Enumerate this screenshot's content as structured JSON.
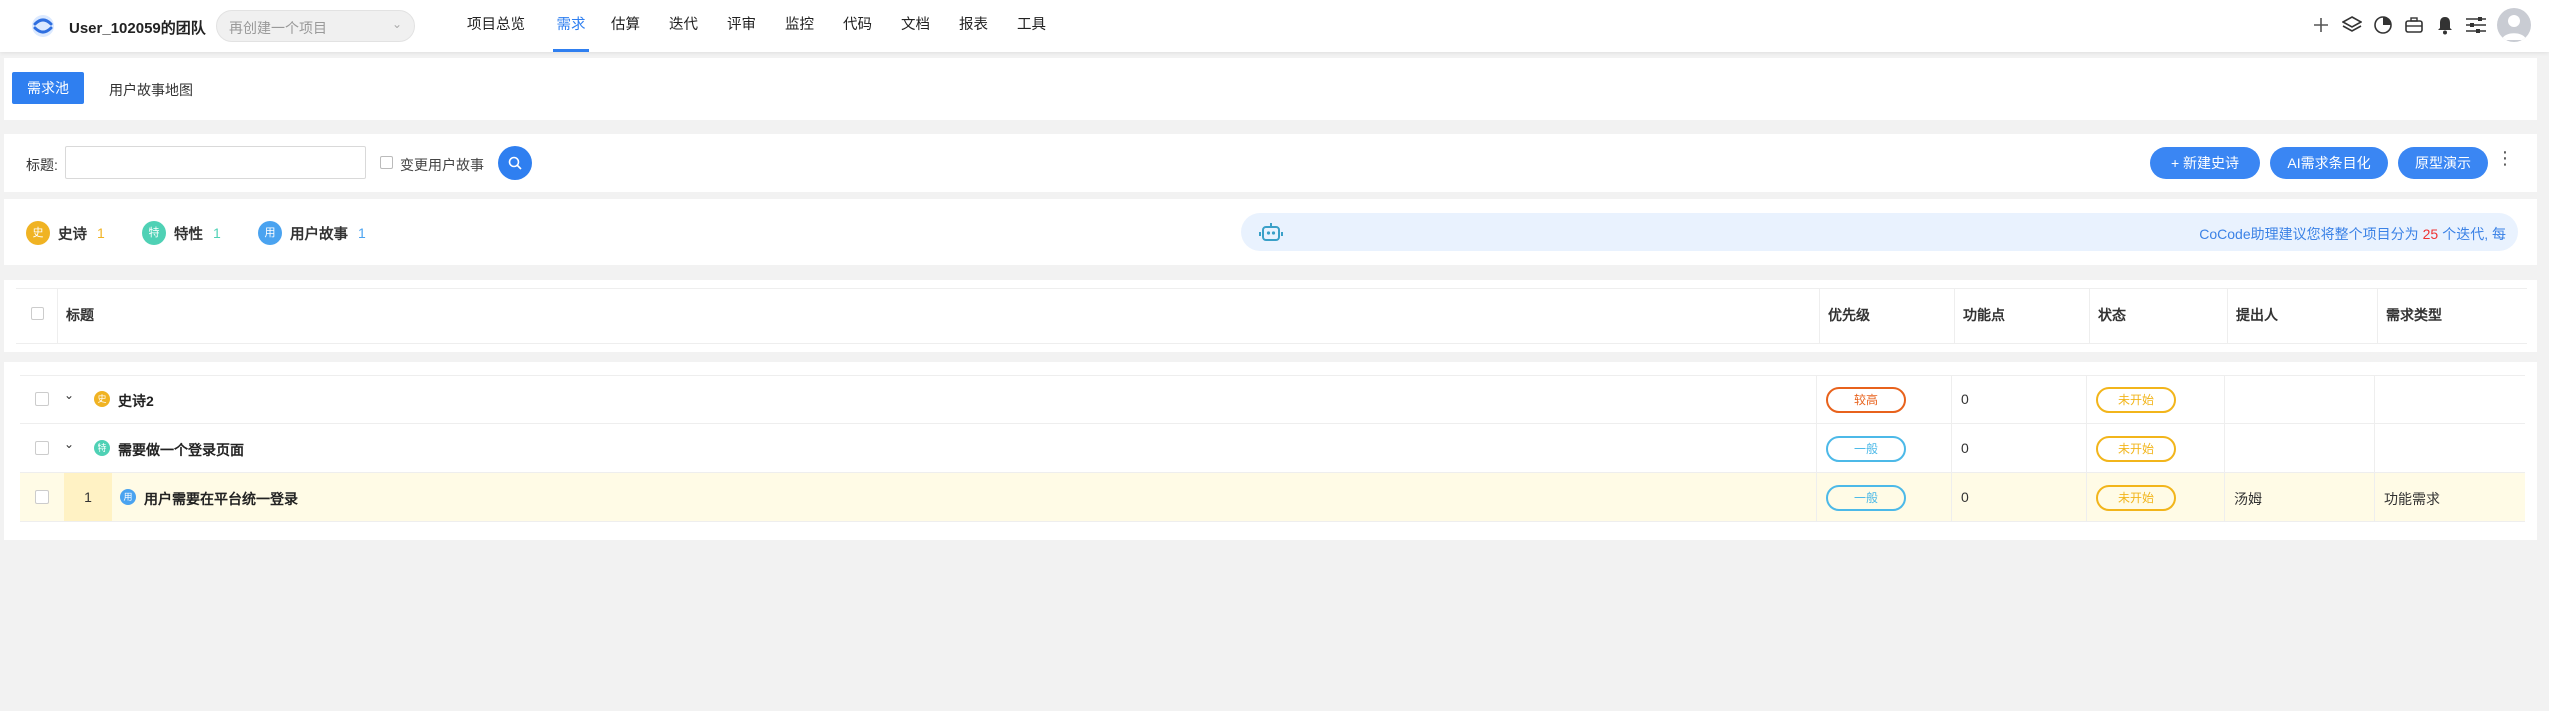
{
  "topbar": {
    "team_name": "User_102059的团队",
    "project_select_placeholder": "再创建一个项目",
    "nav": [
      "项目总览",
      "需求",
      "估算",
      "迭代",
      "评审",
      "监控",
      "代码",
      "文档",
      "报表",
      "工具"
    ],
    "active_nav": "需求",
    "icons": [
      "plus-icon",
      "layers-icon",
      "pie-chart-icon",
      "briefcase-icon",
      "bell-icon",
      "sliders-icon",
      "user-avatar-icon"
    ]
  },
  "tabs": {
    "active": "需求池",
    "other": "用户故事地图"
  },
  "filter": {
    "title_label": "标题:",
    "title_value": "",
    "checkbox_label": "变更用户故事",
    "buttons": {
      "new_epic": "+ 新建史诗",
      "ai_catalog": "AI需求条目化",
      "prototype": "原型演示"
    }
  },
  "stats": {
    "items": [
      {
        "badge": "史",
        "name": "史诗",
        "count": "1",
        "color": "#f0b323"
      },
      {
        "badge": "特",
        "name": "特性",
        "count": "1",
        "color": "#4fd1b5"
      },
      {
        "badge": "用",
        "name": "用户故事",
        "count": "1",
        "color": "#4aa3f0"
      }
    ],
    "assistant_text_before": "CoCode助理建议您将整个项目分为",
    "assistant_number": "25",
    "assistant_text_after": "个迭代, 每"
  },
  "table": {
    "headers": {
      "title": "标题",
      "priority": "优先级",
      "function_points": "功能点",
      "status": "状态",
      "proposer": "提出人",
      "type": "需求类型"
    },
    "rows": [
      {
        "kind_badge": "史",
        "title": "史诗2",
        "priority": "较高",
        "function_points": "0",
        "status": "未开始",
        "proposer": "",
        "type": ""
      },
      {
        "kind_badge": "特",
        "title": "需要做一个登录页面",
        "priority": "一般",
        "function_points": "0",
        "status": "未开始",
        "proposer": "",
        "type": ""
      },
      {
        "number": "1",
        "kind_badge": "用",
        "title": "用户需要在平台统一登录",
        "priority": "一般",
        "function_points": "0",
        "status": "未开始",
        "proposer": "汤姆",
        "type": "功能需求"
      }
    ]
  },
  "colors": {
    "accent": "#2f7ff0",
    "priority_high": "#e8621c",
    "priority_normal": "#4cb9e8",
    "status_pending": "#f2b51b",
    "highlight_row": "#fffbe6"
  }
}
